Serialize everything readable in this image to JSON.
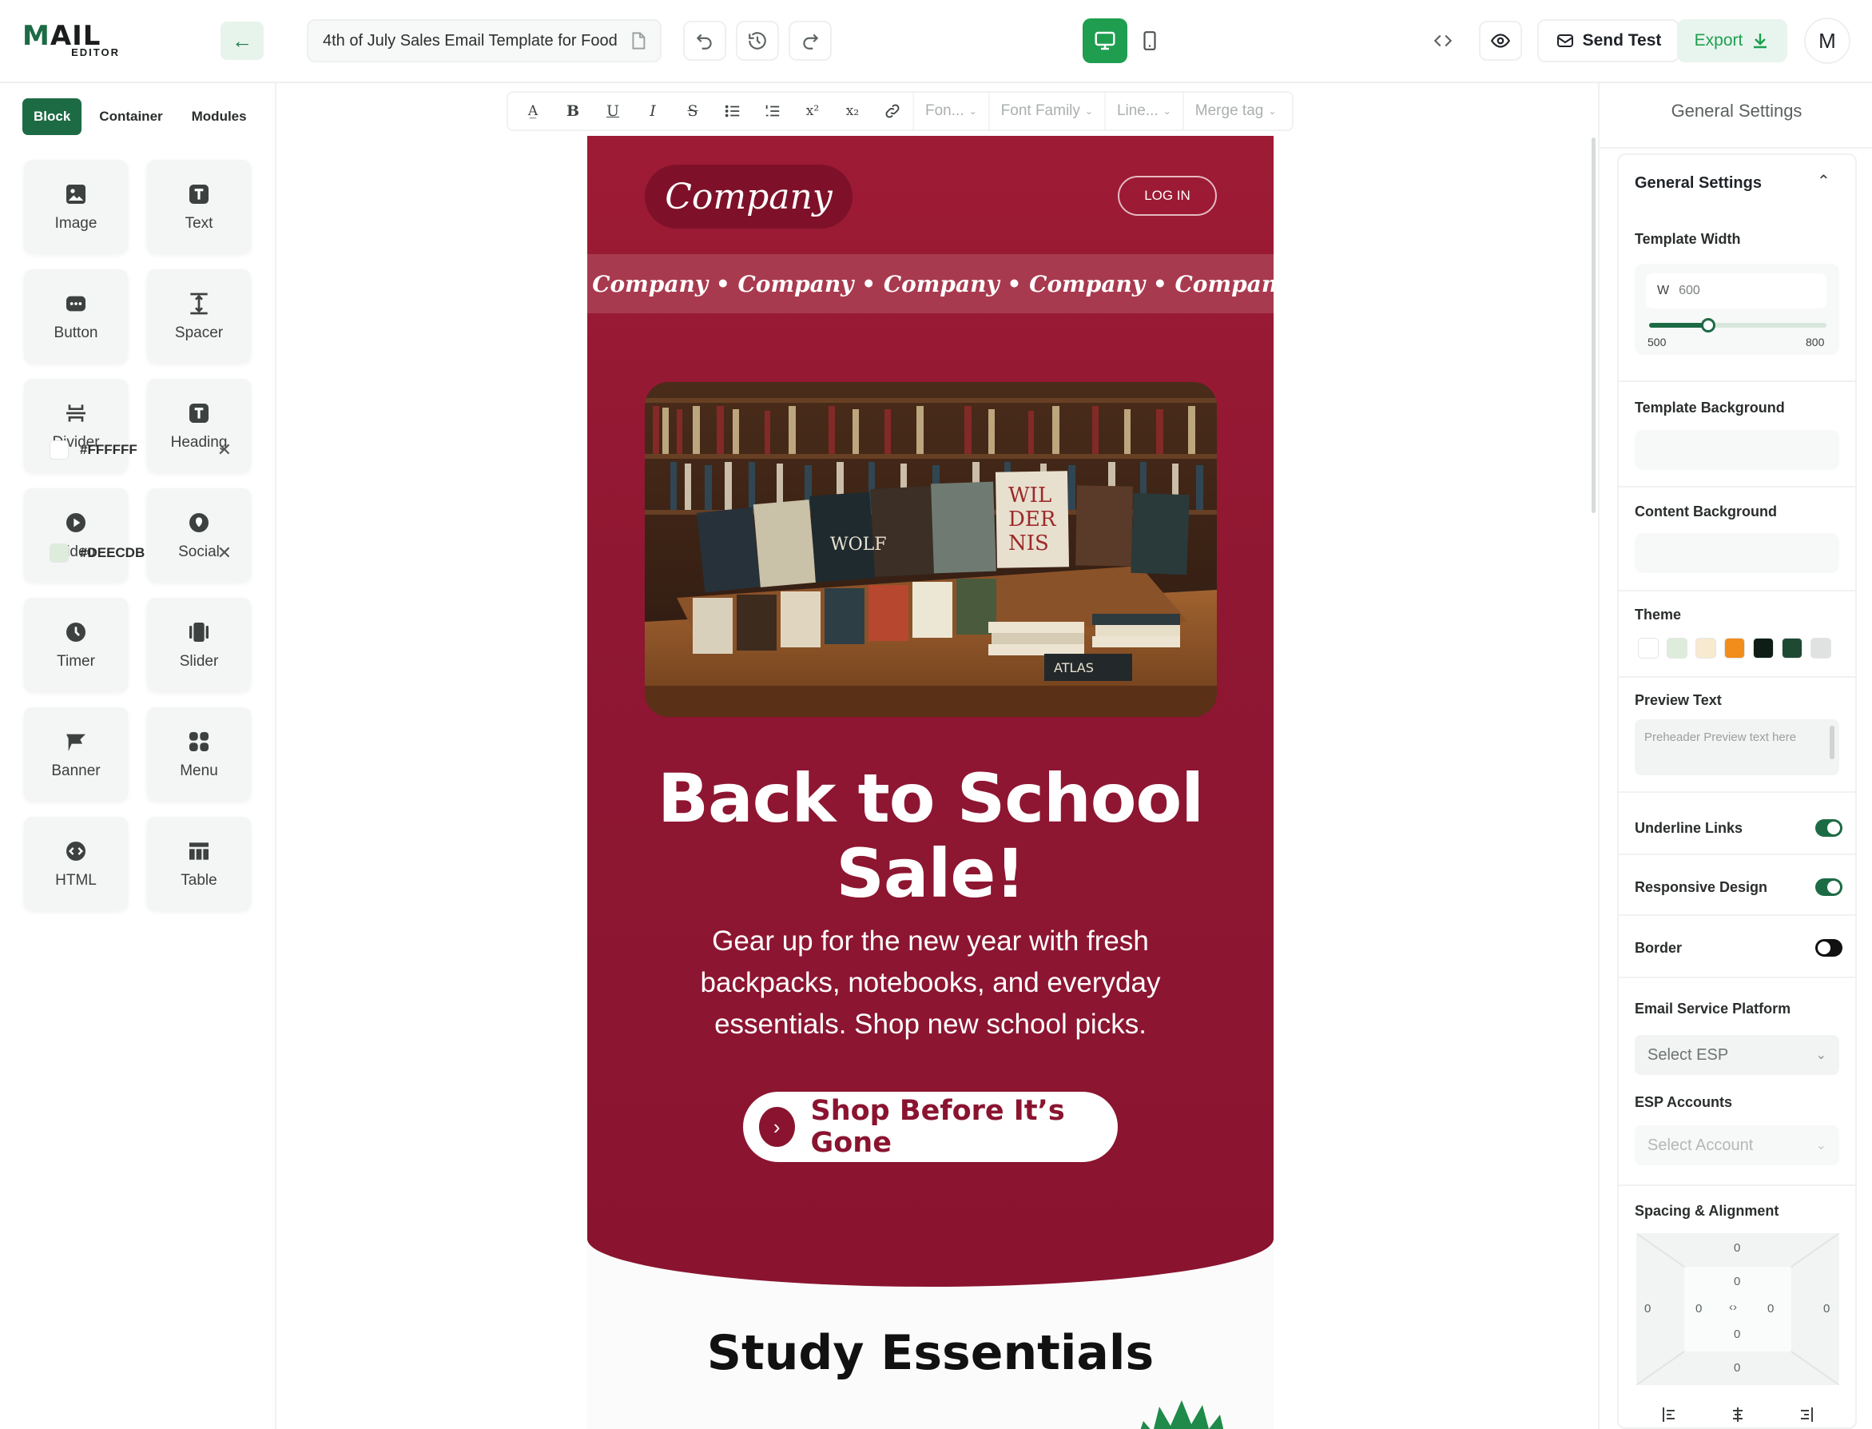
{
  "app": {
    "logo_main": "MAIL",
    "logo_sub": "EDITOR",
    "template_title": "4th of July Sales Email Template for Food",
    "send_test_label": "Send Test",
    "export_label": "Export",
    "avatar_initial": "M",
    "accent": "#1D6B45",
    "accent_bright": "#1F9E4F"
  },
  "left_panel": {
    "tabs": [
      {
        "label": "Block",
        "active": true
      },
      {
        "label": "Container",
        "active": false
      },
      {
        "label": "Modules",
        "active": false
      }
    ],
    "blocks": [
      {
        "label": "Image",
        "icon": "image-icon"
      },
      {
        "label": "Text",
        "icon": "text-icon"
      },
      {
        "label": "Button",
        "icon": "button-icon"
      },
      {
        "label": "Spacer",
        "icon": "spacer-icon"
      },
      {
        "label": "Divider",
        "icon": "divider-icon"
      },
      {
        "label": "Heading",
        "icon": "heading-icon"
      },
      {
        "label": "Video",
        "icon": "video-icon"
      },
      {
        "label": "Social",
        "icon": "social-icon"
      },
      {
        "label": "Timer",
        "icon": "timer-icon"
      },
      {
        "label": "Slider",
        "icon": "slider-icon"
      },
      {
        "label": "Banner",
        "icon": "banner-icon"
      },
      {
        "label": "Menu",
        "icon": "menu-icon"
      },
      {
        "label": "HTML",
        "icon": "html-icon"
      },
      {
        "label": "Table",
        "icon": "table-icon"
      }
    ]
  },
  "toolbar": {
    "font_size_placeholder": "Fon...",
    "font_family_placeholder": "Font Family",
    "line_height_placeholder": "Line...",
    "merge_tag_label": "Merge tag"
  },
  "email": {
    "company_logo_text": "Company",
    "login_label": "LOG IN",
    "marquee_text": "• Company • Company • Company • Company • Company",
    "headline": "Back to School Sale!",
    "subtext": "Gear up for the new year with fresh backpacks, notebooks, and everyday essentials. Shop new school picks.",
    "cta_label": "Shop Before It’s Gone",
    "section_heading": "Study Essentials",
    "hero_color": "#8F1732",
    "image_description_icon": "bookstore-photo"
  },
  "settings": {
    "panel_title": "General Settings",
    "section_title": "General Settings",
    "template_width_label": "Template Width",
    "width_prefix": "W",
    "width_value": "600",
    "width_min": "500",
    "width_max": "800",
    "width_fraction": 0.333,
    "template_background_label": "Template Background",
    "template_background_value": "#FFFFFF",
    "content_background_label": "Content Background",
    "content_background_value": "#DEECDB",
    "theme_label": "Theme",
    "theme_colors": [
      "#FFFFFF",
      "#DEECDB",
      "#F8EAD0",
      "#F28C1B",
      "#0E1E16",
      "#1E4A34",
      "#E0E2E1"
    ],
    "preview_text_label": "Preview Text",
    "preview_text_placeholder": "Preheader Preview text here",
    "underline_links_label": "Underline Links",
    "underline_links_on": true,
    "responsive_design_label": "Responsive Design",
    "responsive_design_on": true,
    "border_label": "Border",
    "border_on": false,
    "esp_label": "Email Service Platform",
    "esp_placeholder": "Select ESP",
    "esp_accounts_label": "ESP Accounts",
    "esp_accounts_placeholder": "Select Account",
    "spacing_label": "Spacing & Alignment",
    "spacing_values": {
      "margin_top": "0",
      "padding_top": "0",
      "margin_left": "0",
      "padding_left": "0",
      "padding_right": "0",
      "margin_right": "0",
      "padding_bottom": "0",
      "margin_bottom": "0"
    }
  }
}
